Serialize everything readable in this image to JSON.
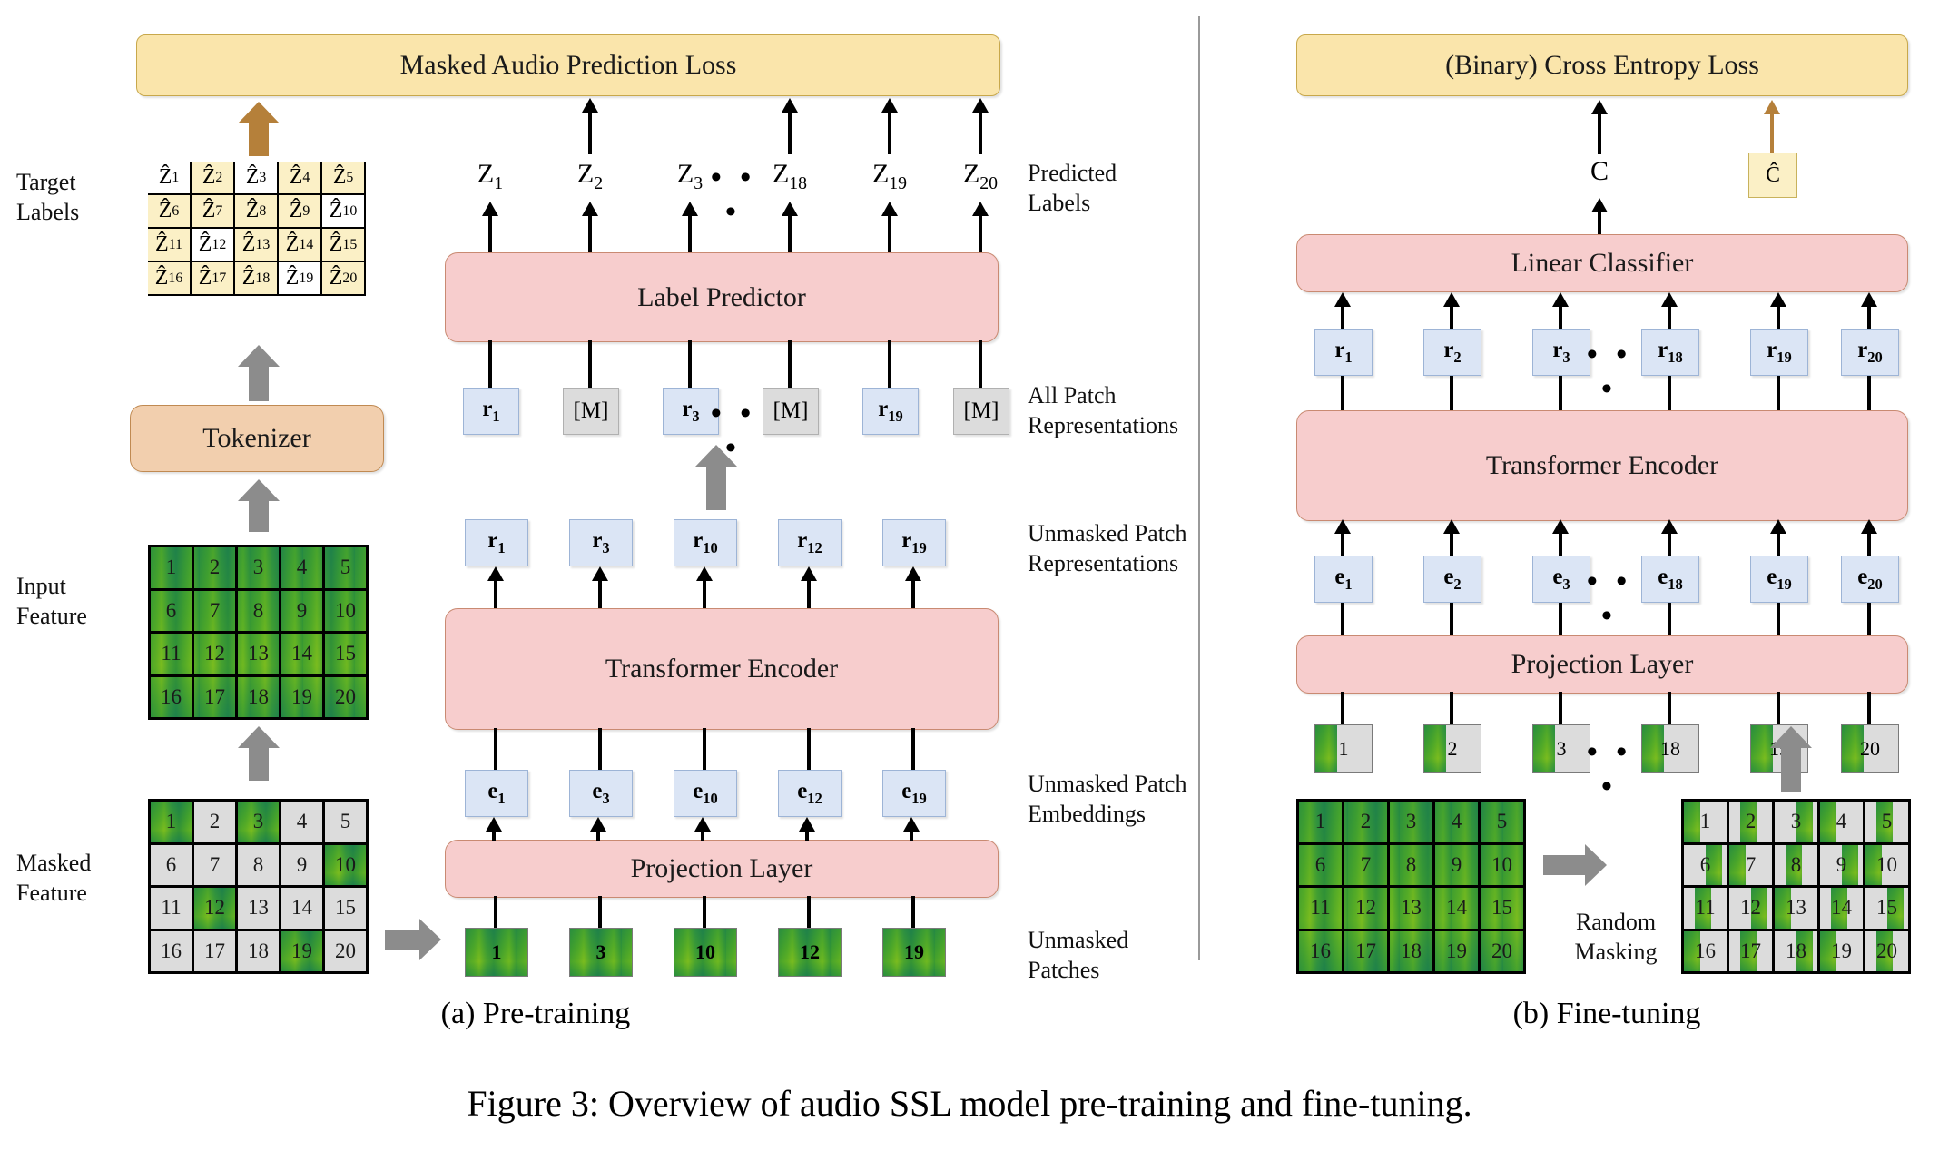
{
  "figure": {
    "caption": "Figure 3: Overview of audio SSL model pre-training and fine-tuning.",
    "panel_a_caption": "(a) Pre-training",
    "panel_b_caption": "(b) Fine-tuning"
  },
  "colors": {
    "loss_box": "#fae5ab",
    "module_box": "#f7cdcd",
    "tokenizer_box": "#f2cfae",
    "repr_token": "#dbe5f5",
    "mask_token": "#dcdcdc",
    "brown_arrow": "#b5803a",
    "gray_arrow": "#8c8c8c"
  },
  "pretraining": {
    "loss_label": "Masked Audio Prediction Loss",
    "tokenizer_label": "Tokenizer",
    "label_predictor_label": "Label Predictor",
    "transformer_encoder_label": "Transformer Encoder",
    "projection_layer_label": "Projection Layer",
    "left_labels": {
      "target_labels": "Target\nLabels",
      "input_feature": "Input\nFeature",
      "masked_feature": "Masked\nFeature"
    },
    "right_labels": {
      "predicted_labels": "Predicted\nLabels",
      "all_patch_representations": "All Patch\nRepresentations",
      "unmasked_patch_representations": "Unmasked Patch\nRepresentations",
      "unmasked_patch_embeddings": "Unmasked Patch\nEmbeddings",
      "unmasked_patches": "Unmasked\nPatches"
    },
    "target_label_grid": [
      {
        "text": "Ẑ1",
        "sub": "1",
        "masked": false
      },
      {
        "text": "Ẑ2",
        "sub": "2",
        "masked": true
      },
      {
        "text": "Ẑ3",
        "sub": "3",
        "masked": false
      },
      {
        "text": "Ẑ4",
        "sub": "4",
        "masked": true
      },
      {
        "text": "Ẑ5",
        "sub": "5",
        "masked": true
      },
      {
        "text": "Ẑ6",
        "sub": "6",
        "masked": true
      },
      {
        "text": "Ẑ7",
        "sub": "7",
        "masked": true
      },
      {
        "text": "Ẑ8",
        "sub": "8",
        "masked": true
      },
      {
        "text": "Ẑ9",
        "sub": "9",
        "masked": true
      },
      {
        "text": "Ẑ10",
        "sub": "10",
        "masked": false
      },
      {
        "text": "Ẑ11",
        "sub": "11",
        "masked": true
      },
      {
        "text": "Ẑ12",
        "sub": "12",
        "masked": false
      },
      {
        "text": "Ẑ13",
        "sub": "13",
        "masked": true
      },
      {
        "text": "Ẑ14",
        "sub": "14",
        "masked": true
      },
      {
        "text": "Ẑ15",
        "sub": "15",
        "masked": true
      },
      {
        "text": "Ẑ16",
        "sub": "16",
        "masked": true
      },
      {
        "text": "Ẑ17",
        "sub": "17",
        "masked": true
      },
      {
        "text": "Ẑ18",
        "sub": "18",
        "masked": true
      },
      {
        "text": "Ẑ19",
        "sub": "19",
        "masked": false
      },
      {
        "text": "Ẑ20",
        "sub": "20",
        "masked": true
      }
    ],
    "predicted_labels": [
      "Z1",
      "Z2",
      "Z3",
      "Z18",
      "Z19",
      "Z20"
    ],
    "predicted_labels_sub": [
      "1",
      "2",
      "3",
      "18",
      "19",
      "20"
    ],
    "all_patch_tokens": [
      {
        "label": "r1",
        "sub": "1",
        "type": "repr"
      },
      {
        "label": "[M]",
        "sub": "",
        "type": "mask"
      },
      {
        "label": "r3",
        "sub": "3",
        "type": "repr"
      },
      {
        "label": "[M]",
        "sub": "",
        "type": "mask"
      },
      {
        "label": "r19",
        "sub": "19",
        "type": "repr"
      },
      {
        "label": "[M]",
        "sub": "",
        "type": "mask"
      }
    ],
    "unmasked_representations": [
      "r1",
      "r3",
      "r10",
      "r12",
      "r19"
    ],
    "unmasked_representations_sub": [
      "1",
      "3",
      "10",
      "12",
      "19"
    ],
    "unmasked_embeddings": [
      "e1",
      "e3",
      "e10",
      "e12",
      "e19"
    ],
    "unmasked_embeddings_sub": [
      "1",
      "3",
      "10",
      "12",
      "19"
    ],
    "unmasked_patches": [
      "1",
      "3",
      "10",
      "12",
      "19"
    ],
    "input_feature_cells": [
      "1",
      "2",
      "3",
      "4",
      "5",
      "6",
      "7",
      "8",
      "9",
      "10",
      "11",
      "12",
      "13",
      "14",
      "15",
      "16",
      "17",
      "18",
      "19",
      "20"
    ],
    "masked_feature_cells": [
      "1",
      "2",
      "3",
      "4",
      "5",
      "6",
      "7",
      "8",
      "9",
      "10",
      "11",
      "12",
      "13",
      "14",
      "15",
      "16",
      "17",
      "18",
      "19",
      "20"
    ],
    "masked_feature_visible": [
      1,
      3,
      10,
      12,
      19
    ],
    "ellipsis": "• • •"
  },
  "finetuning": {
    "loss_label": "(Binary) Cross Entropy Loss",
    "linear_classifier_label": "Linear Classifier",
    "transformer_encoder_label": "Transformer Encoder",
    "projection_layer_label": "Projection Layer",
    "prediction_symbol": "C",
    "target_symbol": "Ĉ",
    "random_masking_label": "Random\nMasking",
    "representations": [
      "r1",
      "r2",
      "r3",
      "r18",
      "r19",
      "r20"
    ],
    "representations_sub": [
      "1",
      "2",
      "3",
      "18",
      "19",
      "20"
    ],
    "embeddings": [
      "e1",
      "e2",
      "e3",
      "e18",
      "e19",
      "e20"
    ],
    "embeddings_sub": [
      "1",
      "2",
      "3",
      "18",
      "19",
      "20"
    ],
    "patches": [
      "1",
      "2",
      "3",
      "18",
      "19",
      "20"
    ],
    "feature_cells": [
      "1",
      "2",
      "3",
      "4",
      "5",
      "6",
      "7",
      "8",
      "9",
      "10",
      "11",
      "12",
      "13",
      "14",
      "15",
      "16",
      "17",
      "18",
      "19",
      "20"
    ],
    "masked_cells": [
      "1",
      "2",
      "3",
      "4",
      "5",
      "6",
      "7",
      "8",
      "9",
      "10",
      "11",
      "12",
      "13",
      "14",
      "15",
      "16",
      "17",
      "18",
      "19",
      "20"
    ],
    "ellipsis": "• • •"
  }
}
